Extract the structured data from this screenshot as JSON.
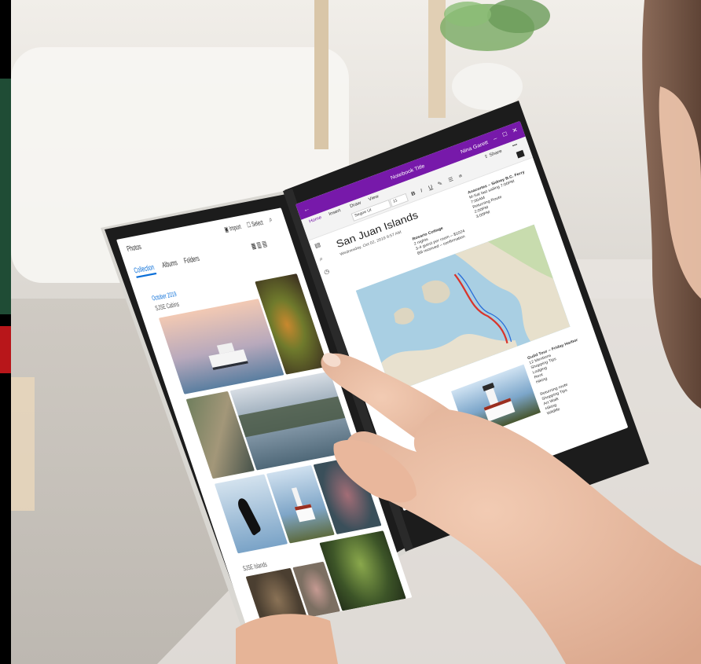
{
  "photos_app": {
    "app_title": "Photos",
    "tabs": [
      {
        "label": "Collection"
      },
      {
        "label": "Albums"
      },
      {
        "label": "Folders"
      }
    ],
    "toolbar": {
      "import_label": "Import",
      "select_label": "Select"
    },
    "sections": [
      {
        "date": "October 2019",
        "location": "SJSE Cabins"
      },
      {
        "date": "",
        "location": "SJSE Islands"
      }
    ]
  },
  "onenote_app": {
    "title_bar": {
      "notebook_name": "Notebook Title",
      "user_name": "Nina Garett"
    },
    "ribbon_tabs": [
      {
        "label": "Home"
      },
      {
        "label": "Insert"
      },
      {
        "label": "Draw"
      },
      {
        "label": "View"
      }
    ],
    "ribbon": {
      "font_name": "Segoe UI",
      "font_size": "11",
      "share_label": "Share"
    },
    "page": {
      "title": "San Juan Islands",
      "meta": "Wednesday, Oct 02, 2019    9:57 AM"
    },
    "notes": {
      "block1_title": "Rosario Cottage",
      "block1_lines": [
        "2 nights",
        "3-4 guest per room – $1024",
        "Bill received – confirmation"
      ],
      "block2_title": "Anacortes – Sidney B.C. Ferry",
      "block2_lines": [
        "M-Sat last sailing 7:00PM",
        "7:00AM",
        "Returning Route",
        "2:00PM",
        "3:00PM"
      ],
      "block3_title": "Guild Tour – Friday Harbor",
      "block3_lines": [
        "12 Mentions",
        "Shopping Tips",
        "Lodging",
        "Rent",
        "Hiking"
      ],
      "block4_lines": [
        "Returning route",
        "Shopping Tips",
        "Art Walk",
        "Hiking",
        "Wildlife"
      ]
    }
  },
  "colors": {
    "onenote_purple": "#7719aa",
    "photos_accent_blue": "#0b6fd8",
    "device_frame": "#1e1e1e",
    "device_silver": "#d9d7d2"
  }
}
